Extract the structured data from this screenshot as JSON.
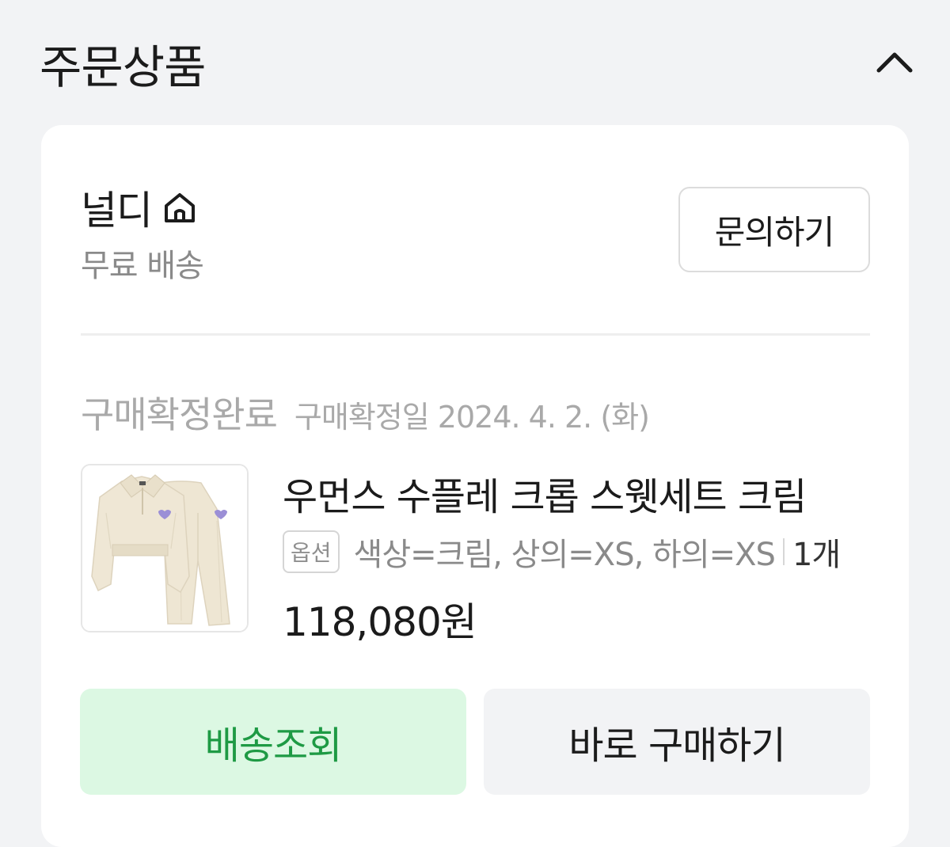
{
  "section": {
    "title": "주문상품",
    "collapse_icon": "chevron-up-icon"
  },
  "order": {
    "seller": {
      "name": "널디",
      "home_icon": "home-icon",
      "shipping": "무료 배송"
    },
    "inquiry_label": "문의하기",
    "status": "구매확정완료",
    "confirm_date": "구매확정일 2024. 4. 2. (화)",
    "product": {
      "name": "우먼스 수플레 크롭 스웻세트 크림",
      "option_badge": "옵션",
      "options": "색상=크림, 상의=XS, 하의=XS",
      "quantity": "1개",
      "price": "118,080원"
    },
    "actions": {
      "track": "배송조회",
      "buy_again": "바로 구매하기"
    }
  },
  "colors": {
    "track_bg": "#dcf8e3",
    "track_text": "#1e9a44",
    "page_bg": "#f2f3f5"
  }
}
